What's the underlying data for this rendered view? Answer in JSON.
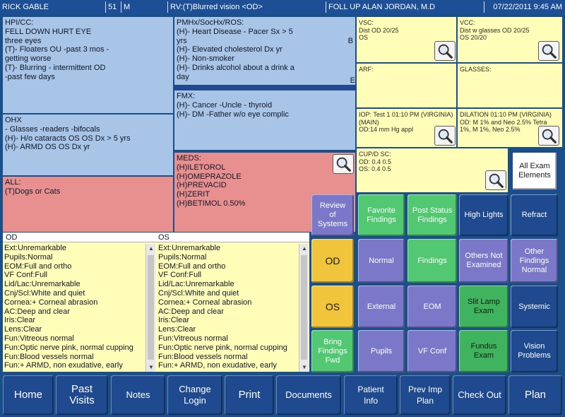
{
  "header": {
    "patient_name": "RICK GABLE",
    "age": "51",
    "sex": "M",
    "reason": "RV:(T)Blurred vision <OD>",
    "visit": "FOLL UP ALAN JORDAN, M.D",
    "datetime": "07/22/2011 9:45 AM"
  },
  "hpi": {
    "lines": [
      "HPI/CC:",
      "FELL DOWN HURT EYE",
      "three eyes",
      "(T)- Floaters OU -past 3 mos  -",
      "getting worse",
      "(T)- Blurring - intermittent OD",
      "-past few days"
    ]
  },
  "pmh": {
    "lines": [
      "PMHx/SocHx/ROS:",
      "(H)- Heart Disease  - Pacer Sx > 5",
      "yrs",
      "(H)- Elevated cholesterol Dx yr",
      "(H)- Non-smoker",
      "(H)- Drinks alcohol about a drink a",
      "day"
    ],
    "edge_b": "B",
    "edge_e": "E"
  },
  "ohx": {
    "lines": [
      "OHX",
      "- Glasses -readers -bifocals",
      "(H)- H/o cataracts OS  OS Dx > 5 yrs",
      "(H)- ARMD OS  OS Dx yr"
    ]
  },
  "fmx": {
    "lines": [
      "FMX:",
      "(H)- Cancer -Uncle  - thyroid",
      "(H)- DM -Father w/o eye complic"
    ]
  },
  "all": {
    "lines": [
      "ALL:",
      "(T)Dogs or Cats"
    ]
  },
  "meds": {
    "lines": [
      "MEDS:",
      "(H)ILETOROL",
      "(H)OMEPRAZOLE",
      "(H)PREVACID",
      "(H)ZERIT",
      "(H)BETIMOL 0.50%"
    ]
  },
  "vsc": {
    "lines": [
      "VSC:",
      "Dist  OD 20/25",
      "OS"
    ]
  },
  "vcc": {
    "lines": [
      "VCC:",
      "Dist w glasses  OD 20/25",
      "OS  20/20"
    ]
  },
  "arf": {
    "lines": [
      "ARF:"
    ]
  },
  "glasses": {
    "lines": [
      "GLASSES:"
    ]
  },
  "iop": {
    "lines": [
      "IOP: Test 1 01:10 PM (VIRGINIA)",
      "(MAIN)",
      "OD:14 mm Hg appl"
    ]
  },
  "dilation": {
    "lines": [
      "DILATION 01:10 PM (VIRGINIA)",
      "OD: M 1% and Neo 2.5% Tetra",
      "1%, M 1%, Neo 2.5%"
    ]
  },
  "cupdisc": {
    "lines": [
      "CUP/D SC:",
      "OD: 0.4 0.5",
      "OS: 0.4 0.5"
    ]
  },
  "exam": {
    "od_header": "OD",
    "os_header": "OS",
    "od_lines": [
      "Ext:Unremarkable",
      "Pupils:Normal",
      "EOM:Full and ortho",
      "VF Conf:Full",
      "Lid/Lac:Unremarkable",
      "Cnj/Scl:White and quiet",
      "Cornea:+ Corneal abrasion",
      "AC:Deep and clear",
      "Iris:Clear",
      "Lens:Clear",
      "Fun:Vitreous normal",
      "Fun:Optic nerve pink, normal cupping",
      "Fun:Blood vessels normal",
      "Fun:+ ARMD, non exudative, early"
    ],
    "os_lines": [
      "Ext:Unremarkable",
      "Pupils:Normal",
      "EOM:Full and ortho",
      "VF Conf:Full",
      "Lid/Lac:Unremarkable",
      "Cnj/Scl:White and quiet",
      "Cornea:+ Corneal abrasion",
      "AC:Deep and clear",
      "Iris:Clear",
      "Lens:Clear",
      "Fun:Vitreous normal",
      "Fun:Optic nerve pink, normal cupping",
      "Fun:Blood vessels normal",
      "Fun:+ ARMD, non exudative, early"
    ]
  },
  "grid": {
    "all_exam": "All Exam\nElements",
    "row1": [
      "Review\nof\nSystems",
      "Favorite\nFindings",
      "Post Status\nFindings",
      "High Lights",
      "Refract"
    ],
    "row2": [
      "OD",
      "Normal",
      "Findings",
      "Others Not\nExamined",
      "Other\nFindings\nNormal"
    ],
    "row3": [
      "OS",
      "External",
      "EOM",
      "Slit Lamp\nExam",
      "Systemic"
    ],
    "row4": [
      "Bring\nFindings\nFwd",
      "Pupils",
      "VF Conf",
      "Fundus\nExam",
      "Vision\nProblems"
    ]
  },
  "nav": [
    "Home",
    "Past\nVisits",
    "Notes",
    "Change\nLogin",
    "Print",
    "Documents",
    "Patient\nInfo",
    "Prev Imp\nPlan",
    "Check Out",
    "Plan"
  ],
  "colors": {
    "header_bg": "#1d4f97",
    "history_blue": "#a8c4e6",
    "allergy_pink": "#e89090",
    "exam_yellow": "#fffdb8",
    "button_purple": "#7b78c9",
    "button_green": "#52c872",
    "button_navy": "#1f4a8f",
    "button_yellow": "#f0c43b"
  },
  "icons": [
    "magnifier-icon"
  ]
}
